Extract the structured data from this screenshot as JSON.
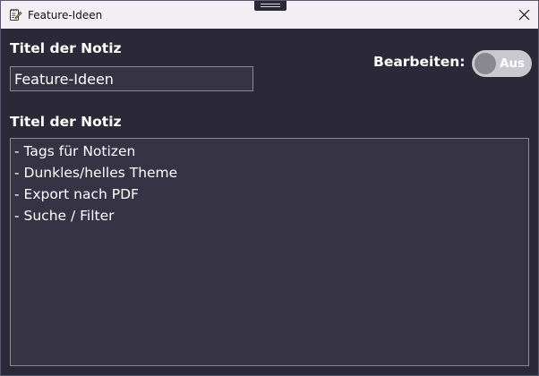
{
  "window": {
    "title": "Feature-Ideen"
  },
  "form": {
    "title_label": "Titel der Notiz",
    "title_value": "Feature-Ideen",
    "edit_label": "Bearbeiten:",
    "edit_toggle_state": "Aus",
    "content_label": "Titel der Notiz",
    "content_lines": [
      "- Tags für Notizen",
      "- Dunkles/helles Theme",
      "- Export nach PDF",
      "- Suche / Filter"
    ]
  },
  "colors": {
    "background": "#2b2838",
    "titlebar": "#f3eef4",
    "field_background": "#353344",
    "field_border": "#8a8898",
    "toggle_track": "#c9c7cf",
    "toggle_knob": "#8a888f"
  },
  "icons": {
    "app": "notepad-icon",
    "close": "close-icon"
  }
}
